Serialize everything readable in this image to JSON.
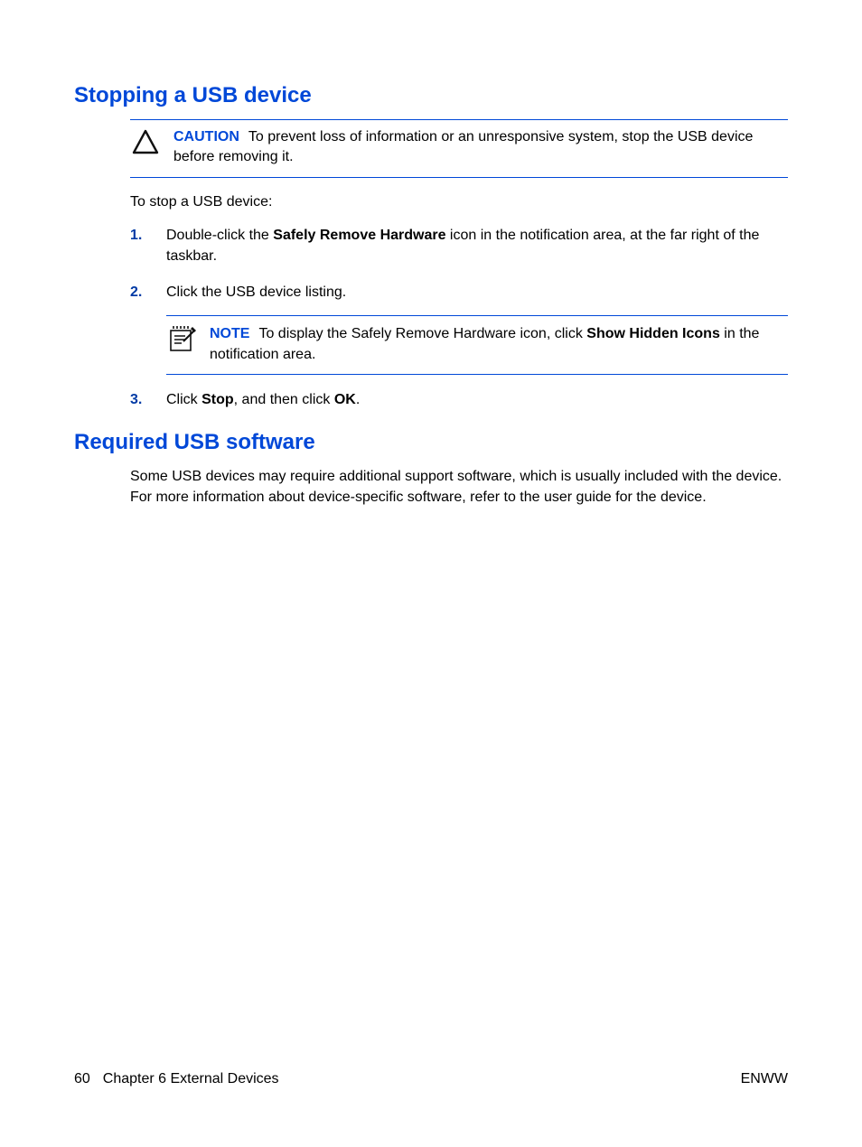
{
  "section1": {
    "heading": "Stopping a USB device",
    "caution": {
      "label": "CAUTION",
      "text": "To prevent loss of information or an unresponsive system, stop the USB device before removing it."
    },
    "intro": "To stop a USB device:",
    "steps": {
      "s1": {
        "pre": "Double-click the ",
        "bold": "Safely Remove Hardware",
        "post": " icon in the notification area, at the far right of the taskbar."
      },
      "s2": {
        "text": "Click the USB device listing."
      },
      "note": {
        "label": "NOTE",
        "pre": "To display the Safely Remove Hardware icon, click ",
        "bold": "Show Hidden Icons",
        "post": " in the notification area."
      },
      "s3": {
        "t1": "Click ",
        "b1": "Stop",
        "t2": ", and then click ",
        "b2": "OK",
        "t3": "."
      }
    }
  },
  "section2": {
    "heading": "Required USB software",
    "body": "Some USB devices may require additional support software, which is usually included with the device. For more information about device-specific software, refer to the user guide for the device."
  },
  "footer": {
    "page": "60",
    "chapter": "Chapter 6   External Devices",
    "right": "ENWW"
  }
}
